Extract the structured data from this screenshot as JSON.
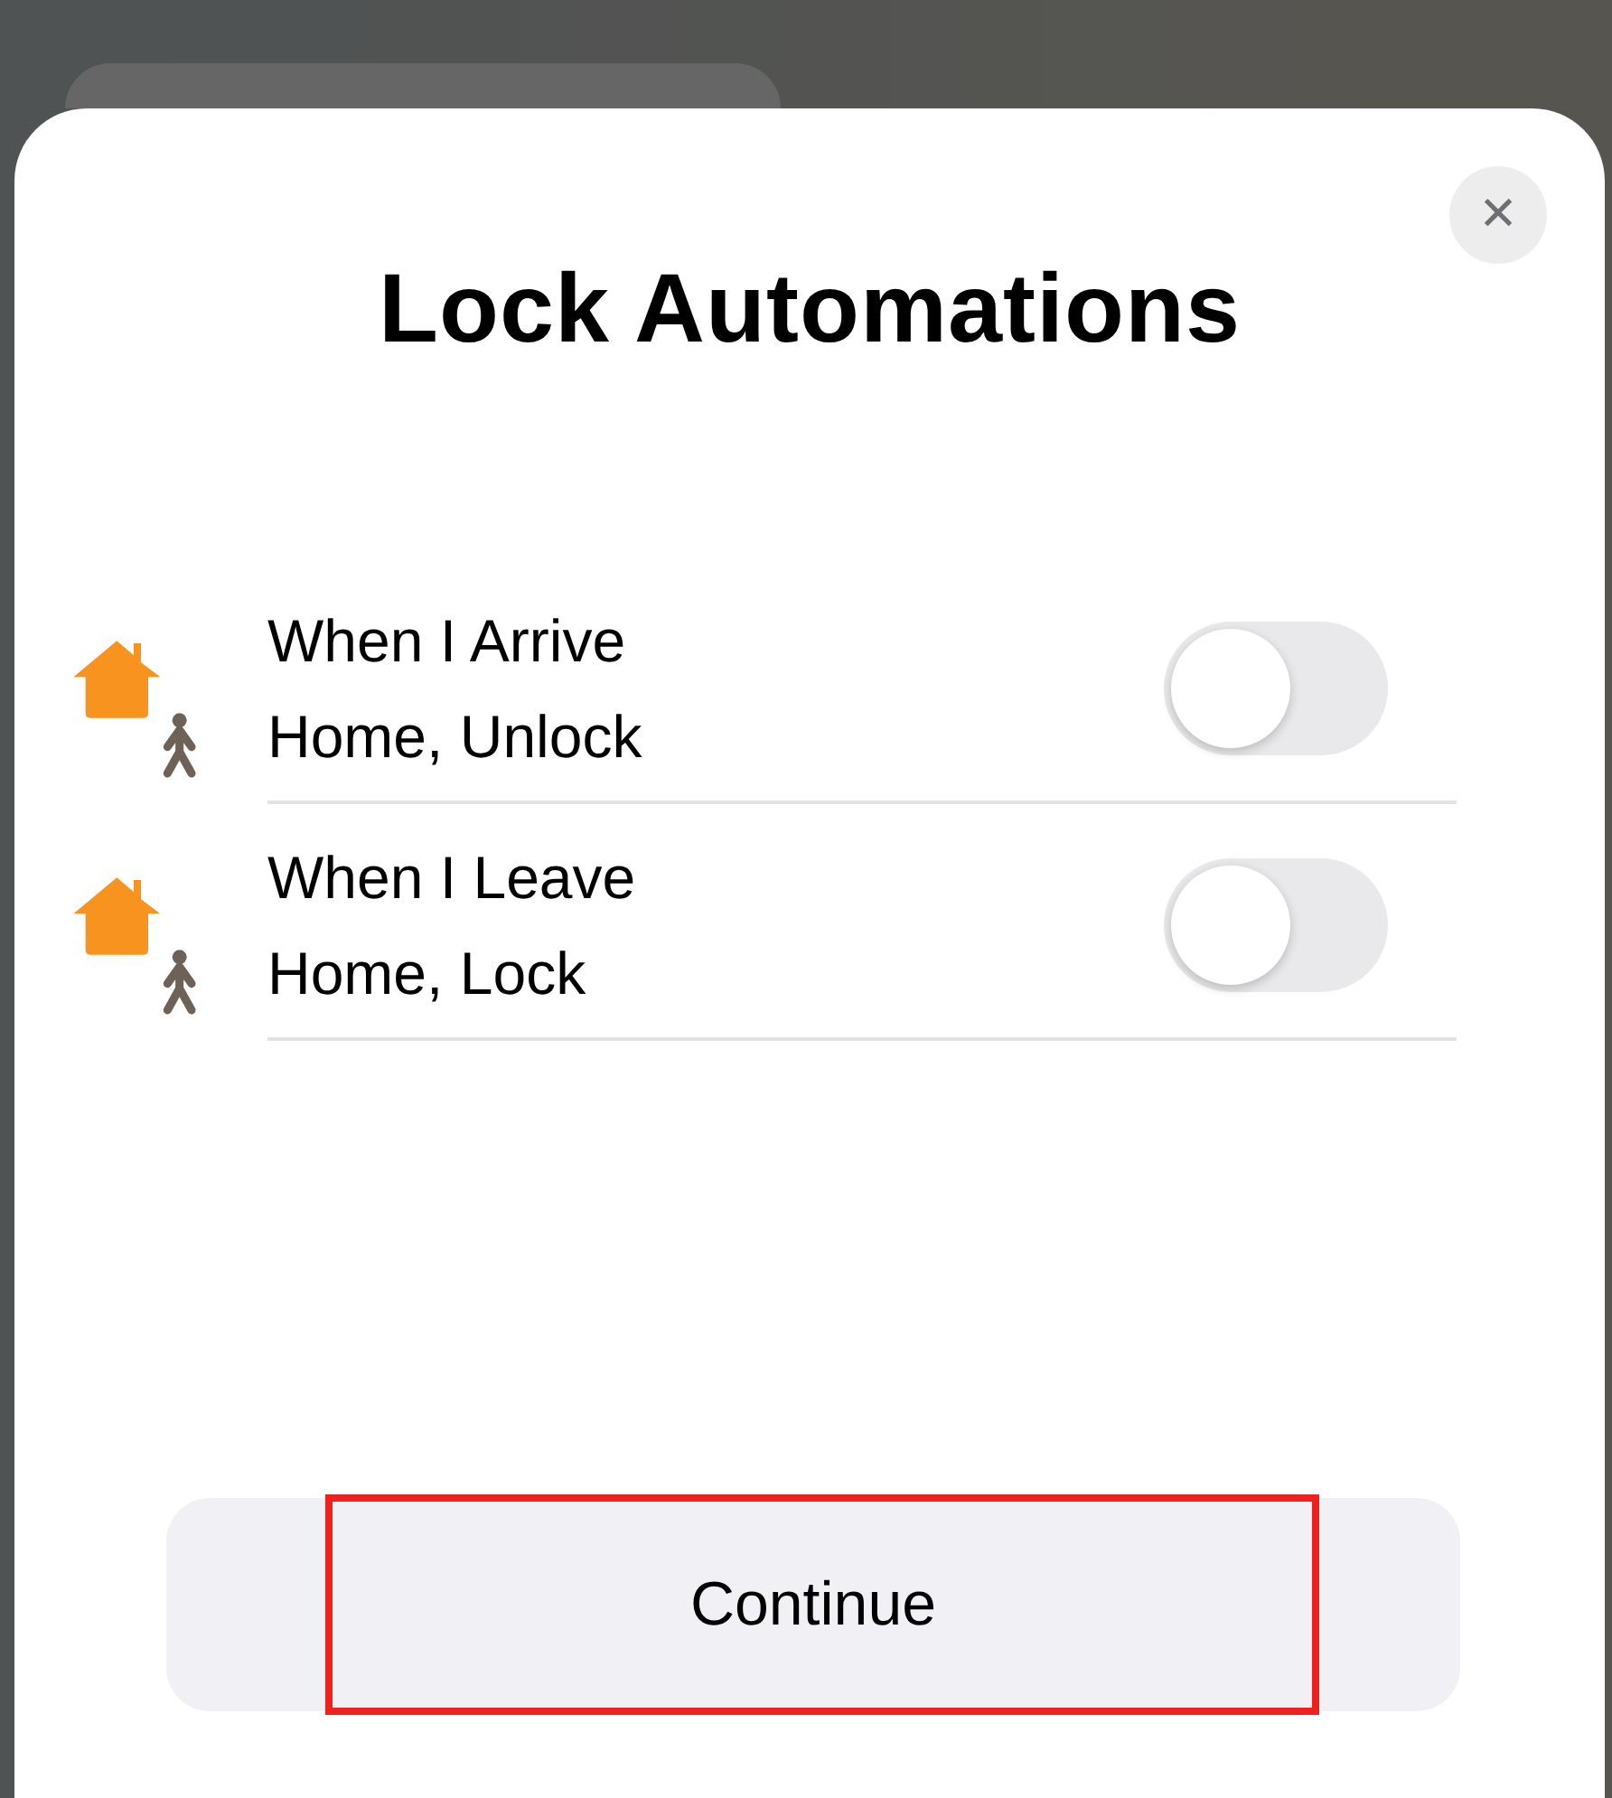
{
  "sheet": {
    "title": "Lock Automations",
    "close_label": "✕"
  },
  "automations": [
    {
      "label": "When I Arrive Home, Unlock",
      "on": false
    },
    {
      "label": "When I Leave Home, Lock",
      "on": false
    }
  ],
  "continue_button": {
    "label": "Continue",
    "highlighted": true
  }
}
